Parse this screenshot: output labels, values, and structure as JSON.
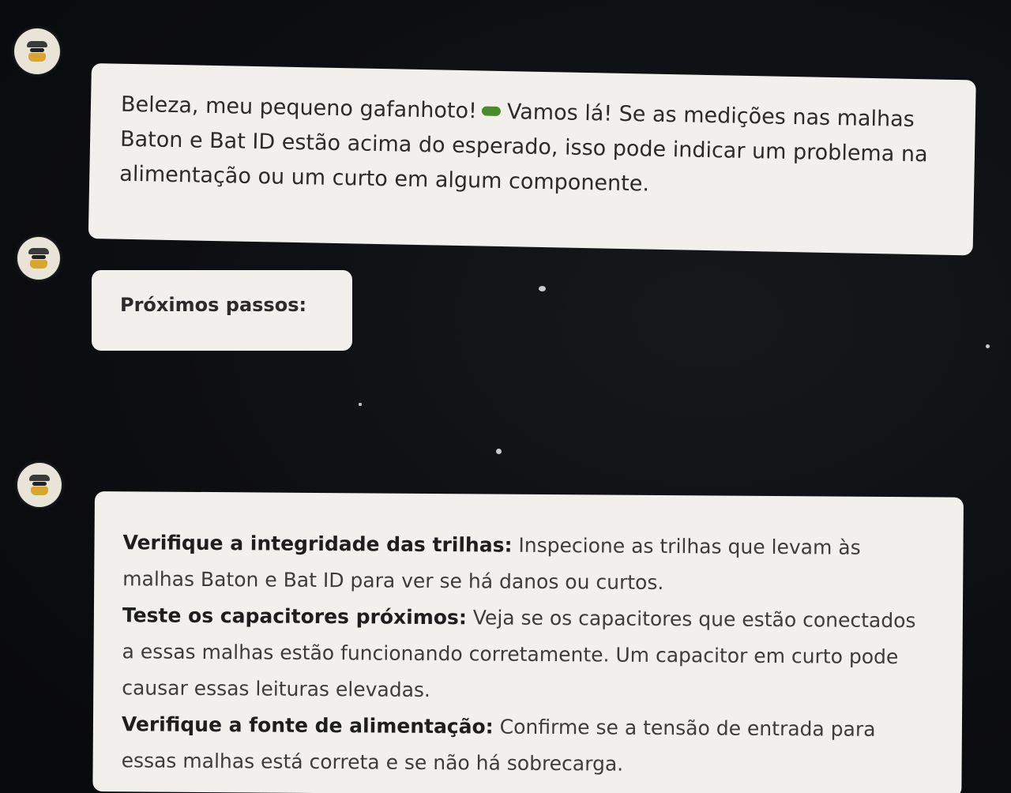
{
  "messages": [
    {
      "avatar_icon": "minion-icon",
      "text_before_emoji": "Beleza, meu pequeno gafanhoto!",
      "emoji_icon": "grasshopper-icon",
      "text_after_emoji": "Vamos lá! Se as medições nas malhas Baton e Bat ID estão acima do esperado, isso pode indicar um problema na alimentação ou um curto em algum componente."
    },
    {
      "avatar_icon": "minion-icon",
      "heading": "Próximos passos:"
    },
    {
      "avatar_icon": "minion-icon",
      "items": [
        {
          "title": "Verifique a integridade das trilhas:",
          "text": "Inspecione as trilhas que levam às malhas Baton e Bat ID para ver se há danos ou curtos."
        },
        {
          "title": "Teste os capacitores próximos:",
          "text": "Veja se os capacitores que estão conectados a essas malhas estão funcionando corretamente. Um capacitor em curto pode causar essas leituras elevadas."
        },
        {
          "title": "Verifique a fonte de alimentação:",
          "text": "Confirme se a tensão de entrada para essas malhas está correta e se não há sobrecarga."
        }
      ]
    }
  ],
  "colors": {
    "background": "#0d0e11",
    "bubble": "#f1f0ec",
    "text": "#2b2b2b"
  }
}
